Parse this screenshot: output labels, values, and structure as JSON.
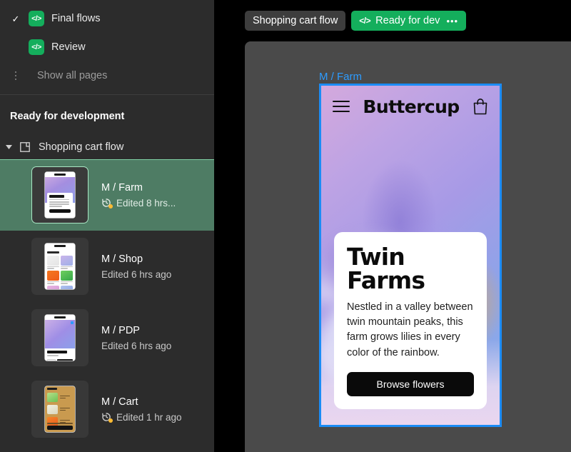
{
  "sidebar": {
    "pages": [
      {
        "label": "Final flows",
        "checked": true,
        "badge": "</>"
      },
      {
        "label": "Review",
        "checked": false,
        "badge": "</>"
      }
    ],
    "show_all_pages": "Show all pages",
    "section_title": "Ready for development",
    "flow": {
      "label": "Shopping cart flow",
      "expanded": true
    },
    "items": [
      {
        "title": "M / Farm",
        "edited": "Edited 8 hrs...",
        "has_clock": true,
        "selected": true
      },
      {
        "title": "M / Shop",
        "edited": "Edited 6 hrs ago",
        "has_clock": false,
        "selected": false
      },
      {
        "title": "M / PDP",
        "edited": "Edited 6 hrs ago",
        "has_clock": false,
        "selected": false
      },
      {
        "title": "M / Cart",
        "edited": "Edited 1 hr ago",
        "has_clock": true,
        "selected": false
      }
    ]
  },
  "topbar": {
    "flow_chip": "Shopping cart flow",
    "status_chip": "Ready for dev",
    "status_badge_glyph": "</>",
    "more_glyph": "•••"
  },
  "canvas": {
    "frame_label": "M / Farm",
    "phone": {
      "brand": "Buttercup",
      "heading": "Twin Farms",
      "body": "Nestled in a valley between twin mountain peaks, this farm grows lilies in every color of the rainbow.",
      "cta": "Browse flowers"
    }
  },
  "colors": {
    "accent_green": "#14ae5c",
    "selection_blue": "#1b8cf5",
    "label_blue": "#2d9cff",
    "selected_row_bg": "#4e7c64",
    "sidebar_bg": "#2c2c2c",
    "canvas_bg": "#4a4a4a",
    "clock_dot": "#ffbb33"
  }
}
